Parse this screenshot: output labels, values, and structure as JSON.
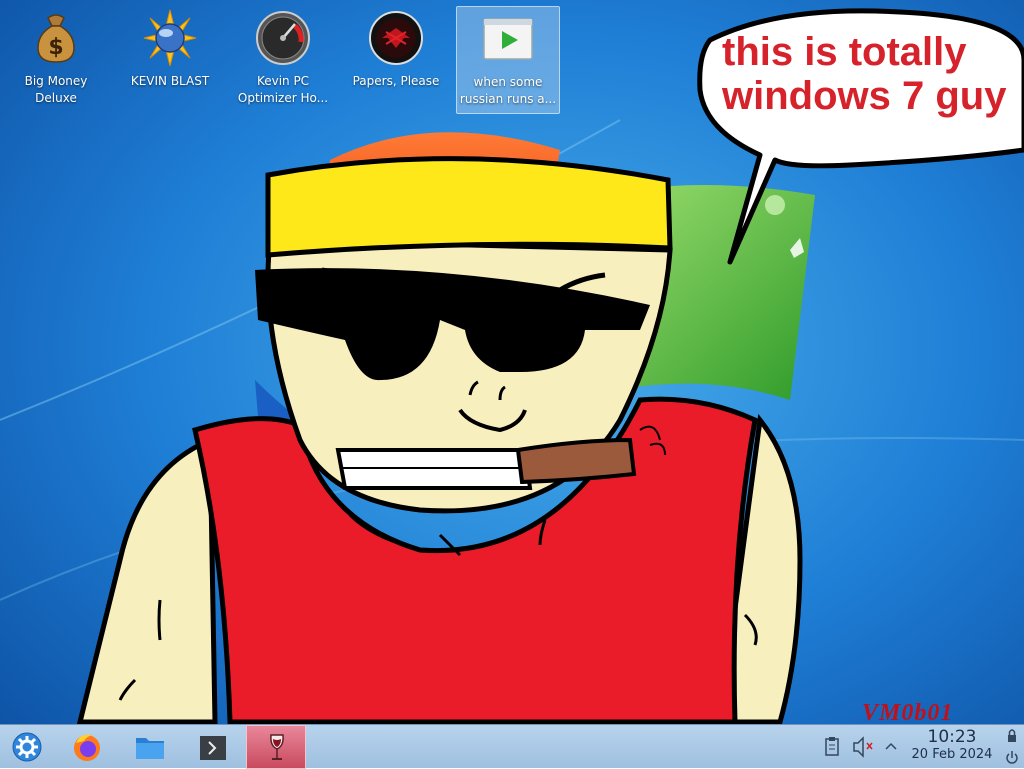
{
  "desktop": {
    "icons": [
      {
        "label": "Big Money Deluxe",
        "icon": "money-bag-icon"
      },
      {
        "label": "KEVIN BLAST",
        "icon": "sun-orb-icon"
      },
      {
        "label": "Kevin PC Optimizer Ho...",
        "icon": "gauge-icon"
      },
      {
        "label": "Papers, Please",
        "icon": "red-emblem-icon"
      },
      {
        "label": "when some russian runs a...",
        "icon": "video-play-icon"
      }
    ],
    "speech_bubble": "this is totally windows 7 guy",
    "watermark": "VM0b01"
  },
  "taskbar": {
    "launchers": [
      "app-menu-icon",
      "firefox-icon",
      "file-manager-icon",
      "terminal-icon"
    ],
    "active_task": "wine-glass-icon",
    "tray": [
      "clipboard-icon",
      "volume-muted-icon",
      "tray-expand-icon"
    ],
    "clock": {
      "time": "10:23",
      "date": "20 Feb 2024"
    },
    "power": [
      "lock-icon",
      "power-icon"
    ]
  },
  "colors": {
    "wallpaper_blue": "#1f7fd6",
    "speech_text": "#d6222b",
    "taskbar": "#b8d3ec"
  }
}
